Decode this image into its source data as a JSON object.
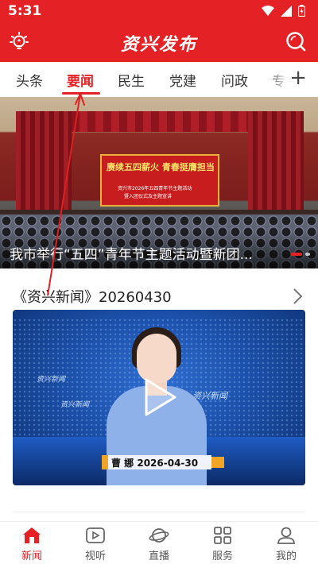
{
  "status_bar": {
    "time": "5:31"
  },
  "header": {
    "title": "资兴发布"
  },
  "tabs": [
    {
      "label": "头条"
    },
    {
      "label": "要闻"
    },
    {
      "label": "民生"
    },
    {
      "label": "党建"
    },
    {
      "label": "问政"
    },
    {
      "label": "专"
    }
  ],
  "tabs_add_label": "+",
  "hero": {
    "caption": "我市举行“五四”青年节主题活动暨新团...",
    "screen_title": "赓续五四薪火 青春挺膺担当",
    "screen_sub1": "资兴市2026年五四青年节主题活动",
    "screen_sub2": "暨入团仪式及主题宣讲"
  },
  "section": {
    "title": "《资兴新闻》20260430"
  },
  "video": {
    "name_caption": "曹 娜 2026-04-30",
    "tags": [
      "资兴新闻",
      "资兴新闻",
      "资兴新闻"
    ]
  },
  "bottom_nav": [
    {
      "label": "新闻",
      "icon": "home-icon",
      "active": true
    },
    {
      "label": "视听",
      "icon": "play-box-icon",
      "active": false
    },
    {
      "label": "直播",
      "icon": "planet-icon",
      "active": false
    },
    {
      "label": "服务",
      "icon": "grid-icon",
      "active": false
    },
    {
      "label": "我的",
      "icon": "user-icon",
      "active": false
    }
  ],
  "colors": {
    "brand_red": "#e42226",
    "annotation_red": "#e02020"
  }
}
